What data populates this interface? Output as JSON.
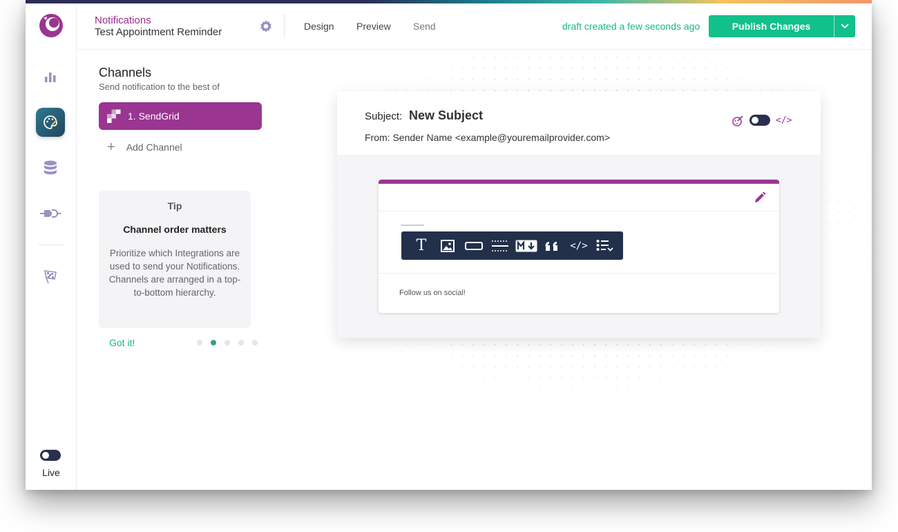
{
  "header": {
    "breadcrumb": "Notifications",
    "title": "Test Appointment Reminder",
    "tabs": [
      {
        "label": "Design"
      },
      {
        "label": "Preview"
      },
      {
        "label": "Send"
      }
    ],
    "status": "draft created a few seconds ago",
    "publish_label": "Publish Changes"
  },
  "rail": {
    "items": [
      {
        "icon": "bar-chart-icon"
      },
      {
        "icon": "palette-icon",
        "active": true
      },
      {
        "icon": "database-icon"
      },
      {
        "icon": "plug-icon"
      },
      {
        "icon": "checkered-flag-icon"
      }
    ],
    "live_label": "Live"
  },
  "channels": {
    "title": "Channels",
    "subtitle": "Send notification to the best of",
    "items": [
      {
        "label": "1.  SendGrid"
      }
    ],
    "add_label": "Add Channel"
  },
  "tip": {
    "heading": "Tip",
    "title": "Channel order matters",
    "body": "Prioritize which Integrations are used to send your Notifications. Channels are arranged in a top-to-bottom hierarchy.",
    "action": "Got it!",
    "page": 2,
    "pages": 5
  },
  "email": {
    "subject_label": "Subject:",
    "subject": "New Subject",
    "from": "From: Sender Name <example@youremailprovider.com>",
    "code_toggle": "</>",
    "footer": "Follow us on social!"
  },
  "toolbar": {
    "tools": [
      "text-icon",
      "image-icon",
      "button-icon",
      "divider-icon",
      "markdown-icon",
      "quote-icon",
      "code-icon",
      "list-icon"
    ],
    "text_glyph": "T",
    "code_glyph": "</>"
  },
  "colors": {
    "brand": "#9a3591",
    "accent": "#11c08a",
    "dark": "#22304b"
  }
}
